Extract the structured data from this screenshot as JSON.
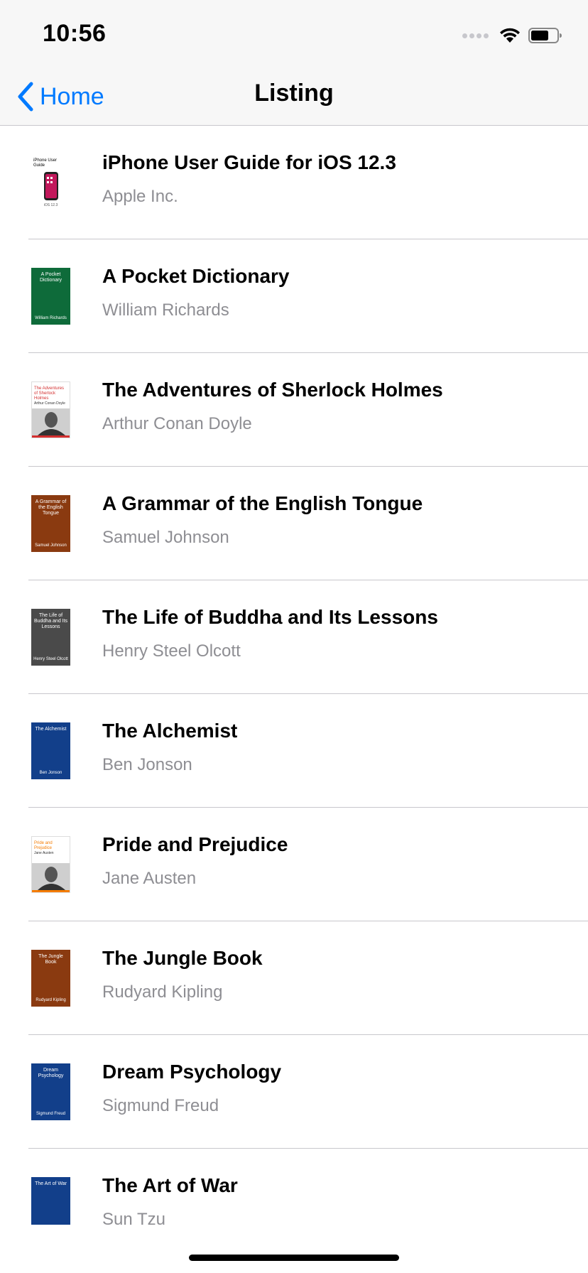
{
  "status_bar": {
    "time": "10:56"
  },
  "nav": {
    "back_label": "Home",
    "title": "Listing"
  },
  "books": [
    {
      "title": "iPhone User Guide for iOS 12.3",
      "author": "Apple Inc.",
      "cover_style": "iphone",
      "cover_title": "iPhone User Guide",
      "cover_author": "iOS 12.3",
      "cover_color": "#ffffff"
    },
    {
      "title": "A Pocket Dictionary",
      "author": "William Richards",
      "cover_style": "solid",
      "cover_title": "A Pocket Dictionary",
      "cover_author": "William Richards",
      "cover_color": "#0e6b3a"
    },
    {
      "title": "The Adventures of Sherlock Holmes",
      "author": "Arthur Conan Doyle",
      "cover_style": "portrait",
      "cover_title": "The Adventures of Sherlock Holmes",
      "cover_author": "Arthur Conan Doyle",
      "cover_color": "#ffffff",
      "accent": "#d32f2f"
    },
    {
      "title": "A Grammar of the English Tongue",
      "author": "Samuel Johnson",
      "cover_style": "solid",
      "cover_title": "A Grammar of the English Tongue",
      "cover_author": "Samuel Johnson",
      "cover_color": "#8a3a10"
    },
    {
      "title": "The Life of Buddha and Its Lessons",
      "author": "Henry Steel Olcott",
      "cover_style": "solid",
      "cover_title": "The Life of Buddha and Its Lessons",
      "cover_author": "Henry Steel Olcott",
      "cover_color": "#4a4a4a"
    },
    {
      "title": "The Alchemist",
      "author": "Ben Jonson",
      "cover_style": "solid",
      "cover_title": "The Alchemist",
      "cover_author": "Ben Jonson",
      "cover_color": "#123f8a"
    },
    {
      "title": "Pride and Prejudice",
      "author": "Jane Austen",
      "cover_style": "portrait",
      "cover_title": "Pride and Prejudice",
      "cover_author": "Jane Austen",
      "cover_color": "#ffffff",
      "accent": "#f57c00"
    },
    {
      "title": "The Jungle Book",
      "author": "Rudyard Kipling",
      "cover_style": "solid",
      "cover_title": "The Jungle Book",
      "cover_author": "Rudyard Kipling",
      "cover_color": "#8a3a10"
    },
    {
      "title": "Dream Psychology",
      "author": "Sigmund Freud",
      "cover_style": "solid",
      "cover_title": "Dream Psychology",
      "cover_author": "Sigmund Freud",
      "cover_color": "#123f8a"
    },
    {
      "title": "The Art of War",
      "author": "Sun Tzu",
      "cover_style": "solid",
      "cover_title": "The Art of War",
      "cover_author": "Sun Tzu",
      "cover_color": "#123f8a"
    }
  ]
}
